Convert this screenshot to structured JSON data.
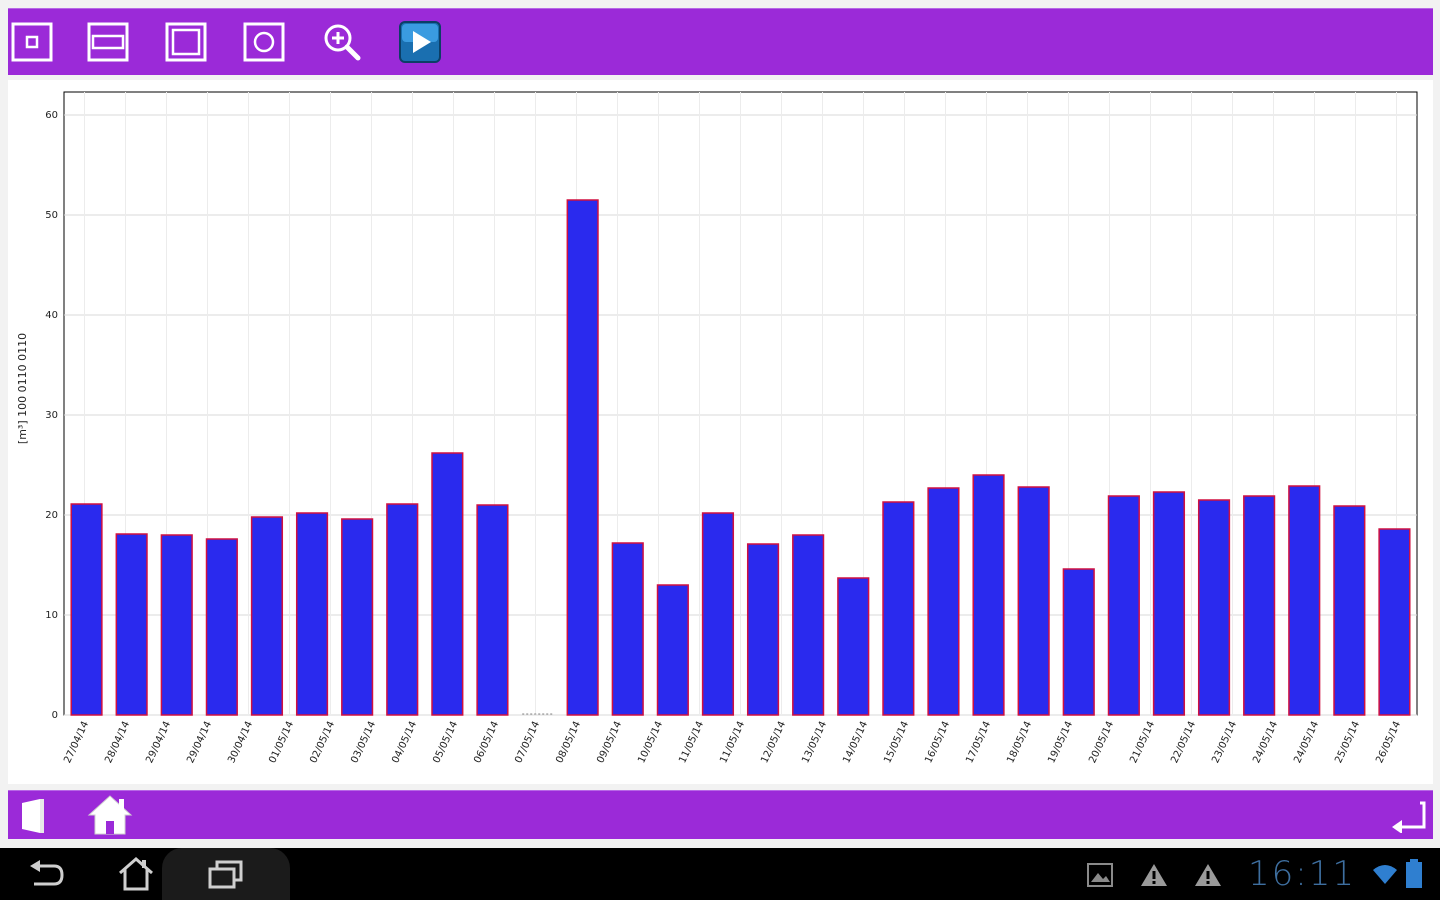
{
  "toolbar": {
    "tools": [
      {
        "name": "zoom-point-icon"
      },
      {
        "name": "zoom-horizontal-icon"
      },
      {
        "name": "zoom-frame-icon"
      },
      {
        "name": "zoom-circle-icon"
      },
      {
        "name": "magnifier-zoom-in-icon"
      },
      {
        "name": "play-icon"
      }
    ]
  },
  "colors": {
    "bar_bg": "#9b2ad8",
    "bar_fill": "#2a2aee",
    "bar_stroke": "#d01040"
  },
  "chart_data": {
    "type": "bar",
    "ylabel": "[m³] 100 0110 0110",
    "ylim": [
      0,
      60
    ],
    "yticks": [
      0,
      10,
      20,
      30,
      40,
      50,
      60
    ],
    "grid": true,
    "categories": [
      "27/04/14",
      "28/04/14",
      "29/04/14",
      "29/04/14",
      "30/04/14",
      "01/05/14",
      "02/05/14",
      "03/05/14",
      "04/05/14",
      "05/05/14",
      "06/05/14",
      "07/05/14",
      "08/05/14",
      "09/05/14",
      "10/05/14",
      "11/05/14",
      "11/05/14",
      "12/05/14",
      "13/05/14",
      "14/05/14",
      "15/05/14",
      "16/05/14",
      "17/05/14",
      "18/05/14",
      "19/05/14",
      "20/05/14",
      "21/05/14",
      "22/05/14",
      "23/05/14",
      "24/05/14",
      "24/05/14",
      "25/05/14",
      "26/05/14"
    ],
    "values": [
      21.1,
      18.1,
      18.0,
      17.6,
      19.8,
      20.2,
      19.6,
      21.1,
      26.2,
      21.0,
      0,
      51.5,
      17.2,
      13.0,
      20.2,
      17.1,
      18.0,
      13.7,
      21.3,
      22.7,
      24.0,
      22.8,
      14.6,
      21.9,
      22.3,
      21.5,
      21.9,
      22.9,
      20.9,
      18.6
    ]
  },
  "system": {
    "clock": "16:11"
  }
}
